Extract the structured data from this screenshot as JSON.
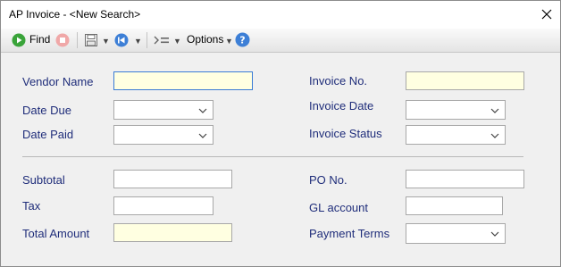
{
  "window": {
    "title": "AP Invoice - <New Search>"
  },
  "toolbar": {
    "find_label": "Find",
    "options_label": "Options"
  },
  "fields": {
    "vendor_name": {
      "label": "Vendor Name",
      "value": ""
    },
    "date_due": {
      "label": "Date Due",
      "value": ""
    },
    "date_paid": {
      "label": "Date Paid",
      "value": ""
    },
    "invoice_no": {
      "label": "Invoice No.",
      "value": ""
    },
    "invoice_date": {
      "label": "Invoice Date",
      "value": ""
    },
    "invoice_status": {
      "label": "Invoice Status",
      "value": ""
    },
    "subtotal": {
      "label": "Subtotal",
      "value": ""
    },
    "tax": {
      "label": "Tax",
      "value": ""
    },
    "total_amount": {
      "label": "Total Amount",
      "value": ""
    },
    "po_no": {
      "label": "PO No.",
      "value": ""
    },
    "gl_account": {
      "label": "GL account",
      "value": ""
    },
    "payment_terms": {
      "label": "Payment Terms",
      "value": ""
    }
  },
  "colors": {
    "label": "#1f2d7a",
    "required_bg": "#ffffe1",
    "focus_border": "#3a7bd5"
  }
}
